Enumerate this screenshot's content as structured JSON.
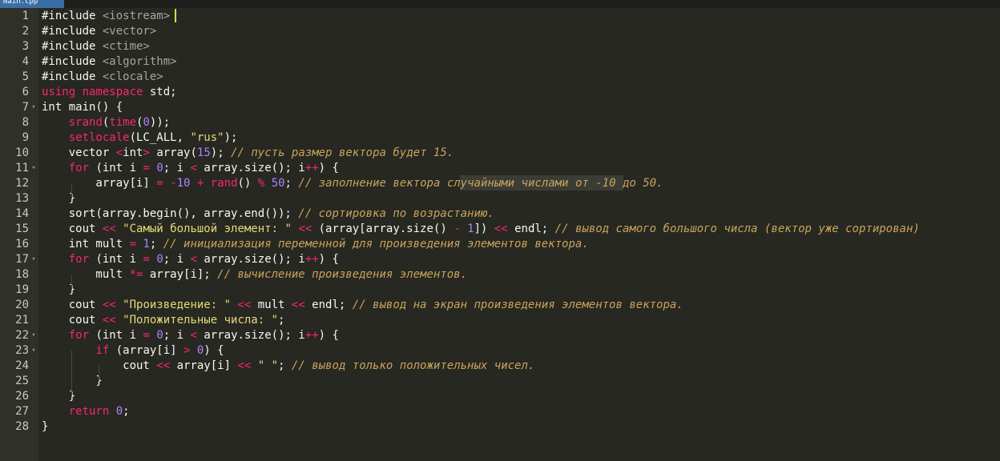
{
  "tab": {
    "label": "main.cpp"
  },
  "lines": [
    {
      "n": "1",
      "fold": "",
      "t": [
        {
          "c": "#include "
        },
        {
          "s": "inc",
          "c": "<iostream>"
        }
      ]
    },
    {
      "n": "2",
      "fold": "",
      "t": [
        {
          "c": "#include "
        },
        {
          "s": "inc",
          "c": "<vector>"
        }
      ]
    },
    {
      "n": "3",
      "fold": "",
      "t": [
        {
          "c": "#include "
        },
        {
          "s": "inc",
          "c": "<ctime>"
        }
      ]
    },
    {
      "n": "4",
      "fold": "",
      "t": [
        {
          "c": "#include "
        },
        {
          "s": "inc",
          "c": "<algorithm>"
        }
      ]
    },
    {
      "n": "5",
      "fold": "",
      "t": [
        {
          "c": "#include "
        },
        {
          "s": "inc",
          "c": "<clocale>"
        }
      ]
    },
    {
      "n": "6",
      "fold": "",
      "t": [
        {
          "s": "kw",
          "c": "using namespace"
        },
        {
          "c": " std;"
        }
      ]
    },
    {
      "n": "7",
      "fold": "▾",
      "t": [
        {
          "c": "int main() {"
        }
      ]
    },
    {
      "n": "8",
      "fold": "",
      "t": [
        {
          "c": "    "
        },
        {
          "s": "fn",
          "c": "srand"
        },
        {
          "c": "("
        },
        {
          "s": "fn",
          "c": "time"
        },
        {
          "c": "("
        },
        {
          "s": "num",
          "c": "0"
        },
        {
          "c": "));"
        }
      ]
    },
    {
      "n": "9",
      "fold": "",
      "t": [
        {
          "c": "    "
        },
        {
          "s": "fn",
          "c": "setlocale"
        },
        {
          "c": "(LC_ALL, "
        },
        {
          "s": "str",
          "c": "\"rus\""
        },
        {
          "c": ");"
        }
      ]
    },
    {
      "n": "10",
      "fold": "",
      "t": [
        {
          "c": "    vector "
        },
        {
          "s": "op",
          "c": "<"
        },
        {
          "c": "int"
        },
        {
          "s": "op",
          "c": ">"
        },
        {
          "c": " array("
        },
        {
          "s": "num",
          "c": "15"
        },
        {
          "c": "); "
        },
        {
          "s": "cm",
          "c": "// пусть размер вектора будет 15."
        }
      ]
    },
    {
      "n": "11",
      "fold": "▾",
      "t": [
        {
          "c": "    "
        },
        {
          "s": "kw",
          "c": "for"
        },
        {
          "c": " (int i "
        },
        {
          "s": "op",
          "c": "="
        },
        {
          "c": " "
        },
        {
          "s": "num",
          "c": "0"
        },
        {
          "c": "; i "
        },
        {
          "s": "op",
          "c": "<"
        },
        {
          "c": " array.size(); i"
        },
        {
          "s": "op",
          "c": "++"
        },
        {
          "c": ") {"
        }
      ]
    },
    {
      "n": "12",
      "fold": "",
      "t": [
        {
          "c": "        array[i] "
        },
        {
          "s": "op",
          "c": "="
        },
        {
          "c": " "
        },
        {
          "s": "op",
          "c": "-"
        },
        {
          "s": "num",
          "c": "10"
        },
        {
          "c": " "
        },
        {
          "s": "op",
          "c": "+"
        },
        {
          "c": " "
        },
        {
          "s": "fn",
          "c": "rand"
        },
        {
          "c": "() "
        },
        {
          "s": "op",
          "c": "%"
        },
        {
          "c": " "
        },
        {
          "s": "num",
          "c": "50"
        },
        {
          "c": "; "
        },
        {
          "s": "cm",
          "c": "// заполнение вектора случайными числами от -10 до 50."
        }
      ]
    },
    {
      "n": "13",
      "fold": "",
      "t": [
        {
          "c": "    }"
        }
      ]
    },
    {
      "n": "14",
      "fold": "",
      "t": [
        {
          "c": "    sort(array.begin(), array.end()); "
        },
        {
          "s": "cm",
          "c": "// сортировка по возрастанию."
        }
      ]
    },
    {
      "n": "15",
      "fold": "",
      "t": [
        {
          "c": "    cout "
        },
        {
          "s": "op",
          "c": "<<"
        },
        {
          "c": " "
        },
        {
          "s": "str",
          "c": "\"Самый большой элемент: \""
        },
        {
          "c": " "
        },
        {
          "s": "op",
          "c": "<<"
        },
        {
          "c": " (array[array.size() "
        },
        {
          "s": "op",
          "c": "-"
        },
        {
          "c": " "
        },
        {
          "s": "num",
          "c": "1"
        },
        {
          "c": "]) "
        },
        {
          "s": "op",
          "c": "<<"
        },
        {
          "c": " endl; "
        },
        {
          "s": "cm",
          "c": "// вывод самого большого числа (вектор уже сортирован)"
        }
      ]
    },
    {
      "n": "16",
      "fold": "",
      "t": [
        {
          "c": "    int mult "
        },
        {
          "s": "op",
          "c": "="
        },
        {
          "c": " "
        },
        {
          "s": "num",
          "c": "1"
        },
        {
          "c": "; "
        },
        {
          "s": "cm",
          "c": "// инициализация переменной для произведения элементов вектора."
        }
      ]
    },
    {
      "n": "17",
      "fold": "▾",
      "t": [
        {
          "c": "    "
        },
        {
          "s": "kw",
          "c": "for"
        },
        {
          "c": " (int i "
        },
        {
          "s": "op",
          "c": "="
        },
        {
          "c": " "
        },
        {
          "s": "num",
          "c": "0"
        },
        {
          "c": "; i "
        },
        {
          "s": "op",
          "c": "<"
        },
        {
          "c": " array.size(); i"
        },
        {
          "s": "op",
          "c": "++"
        },
        {
          "c": ") {"
        }
      ]
    },
    {
      "n": "18",
      "fold": "",
      "t": [
        {
          "c": "        mult "
        },
        {
          "s": "op",
          "c": "*="
        },
        {
          "c": " array[i]; "
        },
        {
          "s": "cm",
          "c": "// вычисление произведения элементов."
        }
      ]
    },
    {
      "n": "19",
      "fold": "",
      "t": [
        {
          "c": "    }"
        }
      ]
    },
    {
      "n": "20",
      "fold": "",
      "t": [
        {
          "c": "    cout "
        },
        {
          "s": "op",
          "c": "<<"
        },
        {
          "c": " "
        },
        {
          "s": "str",
          "c": "\"Произведение: \""
        },
        {
          "c": " "
        },
        {
          "s": "op",
          "c": "<<"
        },
        {
          "c": " mult "
        },
        {
          "s": "op",
          "c": "<<"
        },
        {
          "c": " endl; "
        },
        {
          "s": "cm",
          "c": "// вывод на экран произведения элементов вектора."
        }
      ]
    },
    {
      "n": "21",
      "fold": "",
      "t": [
        {
          "c": "    cout "
        },
        {
          "s": "op",
          "c": "<<"
        },
        {
          "c": " "
        },
        {
          "s": "str",
          "c": "\"Положительные числа: \""
        },
        {
          "c": ";"
        }
      ]
    },
    {
      "n": "22",
      "fold": "▾",
      "t": [
        {
          "c": "    "
        },
        {
          "s": "kw",
          "c": "for"
        },
        {
          "c": " (int i "
        },
        {
          "s": "op",
          "c": "="
        },
        {
          "c": " "
        },
        {
          "s": "num",
          "c": "0"
        },
        {
          "c": "; i "
        },
        {
          "s": "op",
          "c": "<"
        },
        {
          "c": " array.size(); i"
        },
        {
          "s": "op",
          "c": "++"
        },
        {
          "c": ") {"
        }
      ]
    },
    {
      "n": "23",
      "fold": "▾",
      "t": [
        {
          "c": "        "
        },
        {
          "s": "kw",
          "c": "if"
        },
        {
          "c": " (array[i] "
        },
        {
          "s": "op",
          "c": ">"
        },
        {
          "c": " "
        },
        {
          "s": "num",
          "c": "0"
        },
        {
          "c": ") {"
        }
      ]
    },
    {
      "n": "24",
      "fold": "",
      "t": [
        {
          "c": "            cout "
        },
        {
          "s": "op",
          "c": "<<"
        },
        {
          "c": " array[i] "
        },
        {
          "s": "op",
          "c": "<<"
        },
        {
          "c": " "
        },
        {
          "s": "str",
          "c": "\" \""
        },
        {
          "c": "; "
        },
        {
          "s": "cm",
          "c": "// вывод только положительных чисел."
        }
      ]
    },
    {
      "n": "25",
      "fold": "",
      "t": [
        {
          "c": "        }"
        }
      ]
    },
    {
      "n": "26",
      "fold": "",
      "t": [
        {
          "c": "    }"
        }
      ]
    },
    {
      "n": "27",
      "fold": "",
      "t": [
        {
          "c": "    "
        },
        {
          "s": "kw",
          "c": "return"
        },
        {
          "c": " "
        },
        {
          "s": "num",
          "c": "0"
        },
        {
          "c": ";"
        }
      ]
    },
    {
      "n": "28",
      "fold": "",
      "t": [
        {
          "c": "}"
        }
      ]
    }
  ]
}
